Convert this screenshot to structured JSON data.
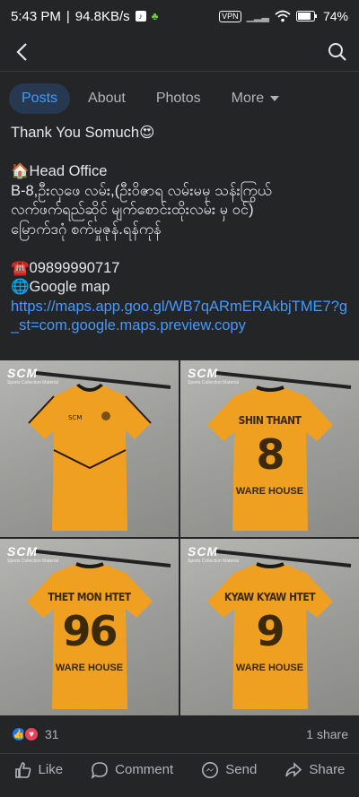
{
  "status": {
    "time": "5:43 PM",
    "speed": "94.8KB/s",
    "vpn": "VPN",
    "battery": "74"
  },
  "tabs": [
    {
      "label": "Posts"
    },
    {
      "label": "About"
    },
    {
      "label": "Photos"
    },
    {
      "label": "More"
    }
  ],
  "post": {
    "line1": "Thank You Somuch😍",
    "line2": "🏠Head Office",
    "line3": "B-8,ဦးလှဖေ လမ်း,(ဦးဝိဇာရ လမ်းမမှ သန်းကြွယ်",
    "line4": "လက်ဖက်ရည်ဆိုင် မျက်စောင်းထိုးလမ်း မှ ဝင်)",
    "line5": "မြောက်ဒဂုံ စက်မှုဇုန်.ရန်ကုန်",
    "phone": "☎️09899990717",
    "map_label": "🌐Google map",
    "link1": "https://maps.app.goo.gl/WB7qARmERAkbjTME7?g",
    "link2": "_st=com.google.maps.preview.copy"
  },
  "photos": [
    {
      "logo": "SCM",
      "logo_sub": "Sports Collection Material",
      "name": "",
      "number": "",
      "warehouse": ""
    },
    {
      "logo": "SCM",
      "logo_sub": "Sports Collection Material",
      "name": "SHIN THANT",
      "number": "8",
      "warehouse": "WARE HOUSE"
    },
    {
      "logo": "SCM",
      "logo_sub": "Sports Collection Material",
      "name": "THET MON HTET",
      "number": "96",
      "warehouse": "WARE HOUSE"
    },
    {
      "logo": "SCM",
      "logo_sub": "Sports Collection Material",
      "name": "KYAW KYAW HTET",
      "number": "9",
      "warehouse": "WARE HOUSE"
    }
  ],
  "reactions": {
    "count": "31",
    "shares": "1 share"
  },
  "actions": {
    "like": "Like",
    "comment": "Comment",
    "send": "Send",
    "share": "Share"
  },
  "colors": {
    "accent": "#4599ff",
    "jersey": "#f0a020",
    "background": "#242526"
  }
}
